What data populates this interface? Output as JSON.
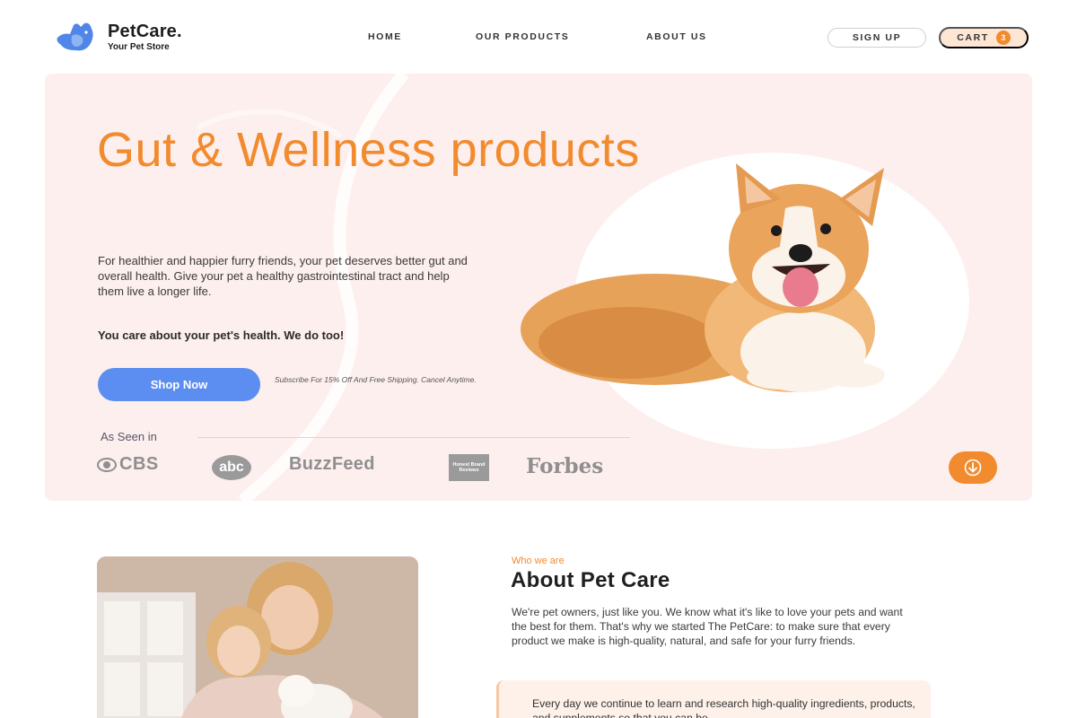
{
  "brand": {
    "name": "PetCare.",
    "tagline": "Your Pet Store"
  },
  "nav": {
    "home": "HOME",
    "products": "OUR PRODUCTS",
    "about": "ABOUT US"
  },
  "header_actions": {
    "signup": "SIGN UP",
    "cart_label": "CART",
    "cart_count": "3"
  },
  "hero": {
    "title": "Gut & Wellness products",
    "description": "For healthier and happier furry friends, your pet deserves better gut and overall health. Give your pet a healthy gastrointestinal tract and help them live a longer life.",
    "strong_line": "You care about your pet's health. We do too!",
    "cta": "Shop Now",
    "subscribe_note": "Subscribe For 15% Off And Free Shipping. Cancel Anytime.",
    "seen_in": "As Seen in",
    "press": {
      "cbs": "CBS",
      "abc": "abc",
      "buzzfeed": "BuzzFeed",
      "honest": "Honest Brand Reviews",
      "forbes": "Forbes"
    }
  },
  "about": {
    "eyebrow": "Who we are",
    "title": "About Pet Care",
    "text": "We're pet owners, just like you. We know what it's like to love your pets and want the best for them. That's why we started The PetCare: to make sure that every product we make is high-quality, natural, and safe for your furry friends.",
    "card_text": "Every day we continue to learn and research high-quality ingredients, products, and supplements so that you can be"
  },
  "colors": {
    "accent_orange": "#f28a2e",
    "button_blue": "#5b8ef0",
    "hero_bg": "#fdefed",
    "logo_blue": "#4f86e8"
  }
}
